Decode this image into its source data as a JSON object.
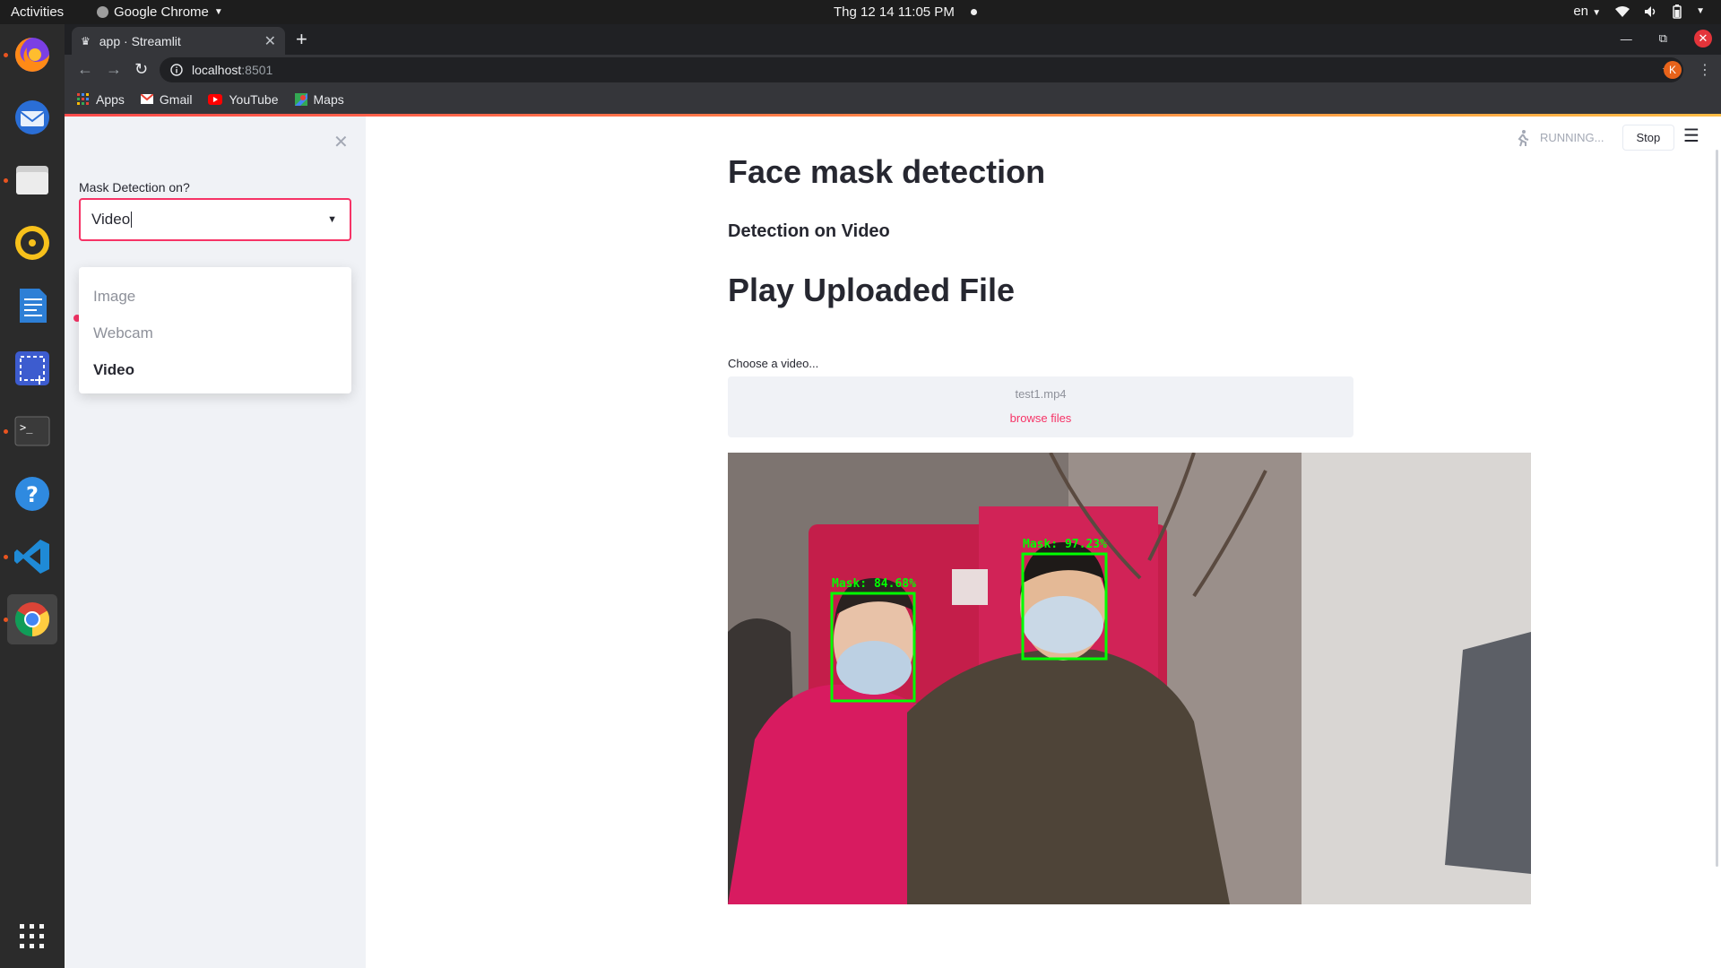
{
  "topbar": {
    "activities": "Activities",
    "app_name": "Google Chrome",
    "datetime": "Thg 12 14  11:05 PM",
    "language": "en"
  },
  "dock": {
    "items": [
      "firefox-icon",
      "thunderbird-icon",
      "files-icon",
      "rhythmbox-icon",
      "writer-icon",
      "screenshot-icon",
      "terminal-icon",
      "help-icon",
      "vscode-icon",
      "chrome-icon",
      "show-apps-icon"
    ]
  },
  "browser": {
    "tab_title": "app · Streamlit",
    "url_host": "localhost",
    "url_port": ":8501",
    "profile_initial": "K",
    "bookmarks": [
      "Apps",
      "Gmail",
      "YouTube",
      "Maps"
    ]
  },
  "sidebar": {
    "select_label": "Mask Detection on?",
    "select_value": "Video",
    "options": [
      "Image",
      "Webcam",
      "Video"
    ],
    "selected_option": "Video"
  },
  "header": {
    "status": "RUNNING...",
    "stop_label": "Stop"
  },
  "main": {
    "title": "Face mask detection",
    "subtitle": "Detection on Video",
    "section_title": "Play Uploaded File",
    "uploader_label": "Choose a video...",
    "uploaded_file": "test1.mp4",
    "browse_label": "browse files"
  },
  "video": {
    "detections": [
      {
        "label": "Mask: 84.68%"
      },
      {
        "label": "Mask: 97.23%"
      }
    ]
  },
  "colors": {
    "accent": "#f63366",
    "detection_box": "#00ff00"
  }
}
